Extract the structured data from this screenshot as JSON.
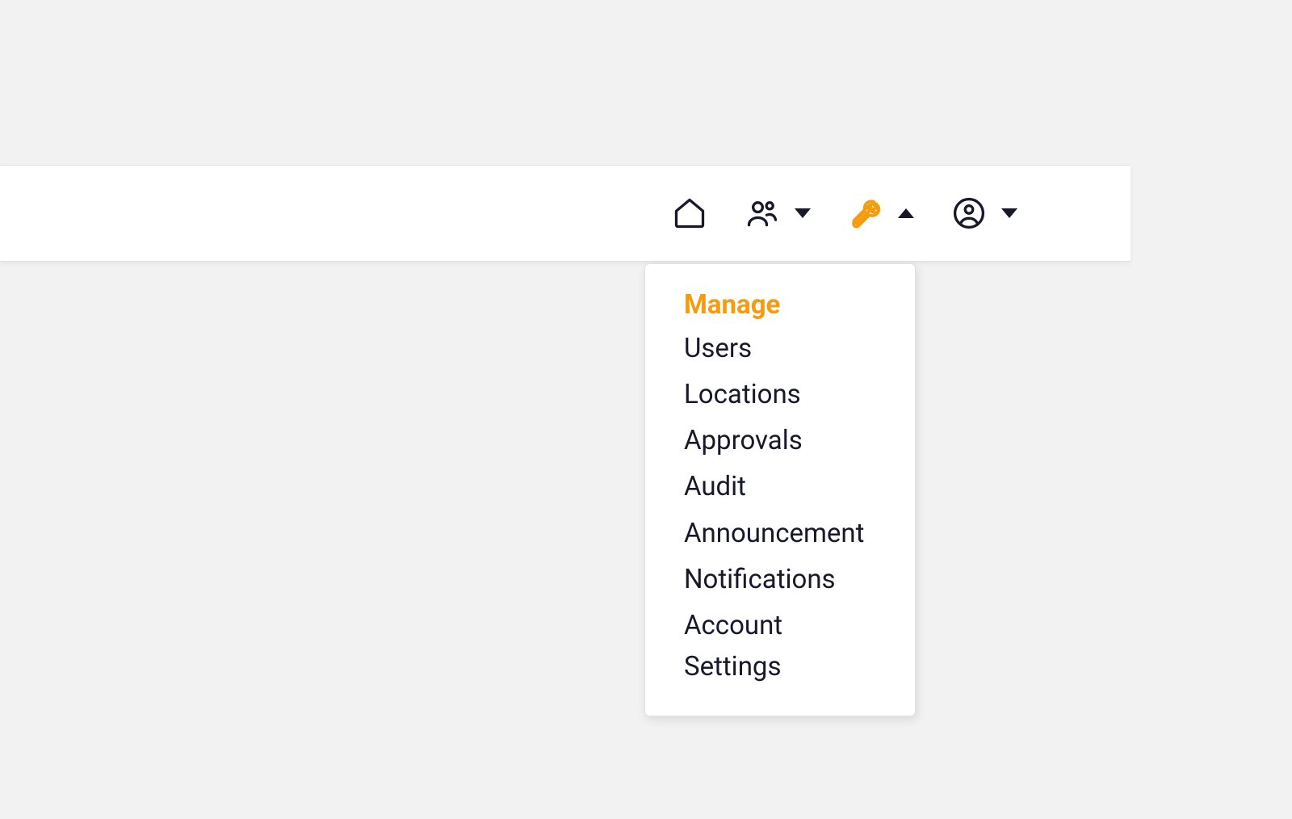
{
  "colors": {
    "accent": "#f59b0e",
    "text": "#18182a"
  },
  "dropdown": {
    "header": "Manage",
    "items": [
      "Users",
      "Locations",
      "Approvals",
      "Audit",
      "Announcement",
      "Notifications",
      "Account Settings"
    ]
  }
}
